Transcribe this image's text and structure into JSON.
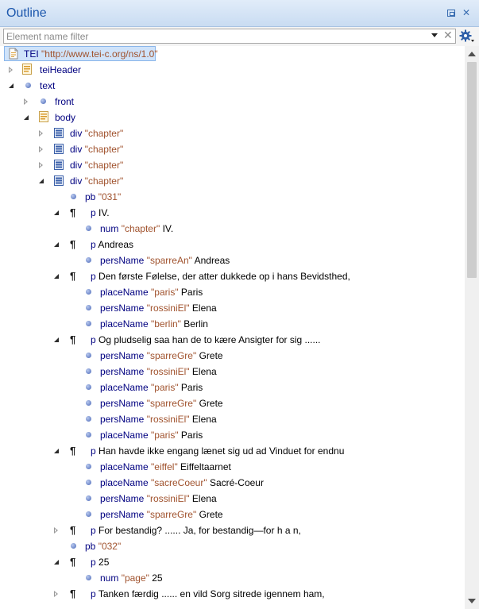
{
  "panel": {
    "title": "Outline",
    "restore_icon": "restore-icon",
    "close_symbol": "✕"
  },
  "filter": {
    "placeholder": "Element name filter",
    "value": "",
    "clear_symbol": "✕"
  },
  "tree": [
    {
      "level": 0,
      "toggle": "none",
      "icon": "document-icon",
      "name": "TEI",
      "attr": "\"http://www.tei-c.org/ns/1.0\"",
      "text": "",
      "selected": true
    },
    {
      "level": 0,
      "toggle": "collapsed",
      "icon": "header-icon",
      "name": "teiHeader",
      "attr": "",
      "text": ""
    },
    {
      "level": 0,
      "toggle": "expanded",
      "icon": "element-dot-icon",
      "name": "text",
      "attr": "",
      "text": ""
    },
    {
      "level": 1,
      "toggle": "collapsed",
      "icon": "element-dot-icon",
      "name": "front",
      "attr": "",
      "text": ""
    },
    {
      "level": 1,
      "toggle": "expanded",
      "icon": "header-icon",
      "name": "body",
      "attr": "",
      "text": ""
    },
    {
      "level": 2,
      "toggle": "collapsed",
      "icon": "div-icon",
      "name": "div",
      "attr": "\"chapter\"",
      "text": ""
    },
    {
      "level": 2,
      "toggle": "collapsed",
      "icon": "div-icon",
      "name": "div",
      "attr": "\"chapter\"",
      "text": ""
    },
    {
      "level": 2,
      "toggle": "collapsed",
      "icon": "div-icon",
      "name": "div",
      "attr": "\"chapter\"",
      "text": ""
    },
    {
      "level": 2,
      "toggle": "expanded",
      "icon": "div-icon",
      "name": "div",
      "attr": "\"chapter\"",
      "text": ""
    },
    {
      "level": 3,
      "toggle": "none",
      "icon": "element-dot-icon",
      "name": "pb",
      "attr": "\"031\"",
      "text": ""
    },
    {
      "level": 3,
      "toggle": "expanded",
      "icon": "pilcrow-icon",
      "name": "p",
      "attr": "",
      "text": "IV."
    },
    {
      "level": 4,
      "toggle": "none",
      "icon": "element-dot-icon",
      "name": "num",
      "attr": "\"chapter\"",
      "text": "IV."
    },
    {
      "level": 3,
      "toggle": "expanded",
      "icon": "pilcrow-icon",
      "name": "p",
      "attr": "",
      "text": "Andreas"
    },
    {
      "level": 4,
      "toggle": "none",
      "icon": "element-dot-icon",
      "name": "persName",
      "attr": "\"sparreAn\"",
      "text": "Andreas"
    },
    {
      "level": 3,
      "toggle": "expanded",
      "icon": "pilcrow-icon",
      "name": "p",
      "attr": "",
      "text": "Den første Følelse, der atter dukkede op i hans Bevidsthed,"
    },
    {
      "level": 4,
      "toggle": "none",
      "icon": "element-dot-icon",
      "name": "placeName",
      "attr": "\"paris\"",
      "text": "Paris"
    },
    {
      "level": 4,
      "toggle": "none",
      "icon": "element-dot-icon",
      "name": "persName",
      "attr": "\"rossiniEl\"",
      "text": "Elena"
    },
    {
      "level": 4,
      "toggle": "none",
      "icon": "element-dot-icon",
      "name": "placeName",
      "attr": "\"berlin\"",
      "text": "Berlin"
    },
    {
      "level": 3,
      "toggle": "expanded",
      "icon": "pilcrow-icon",
      "name": "p",
      "attr": "",
      "text": "Og pludselig saa han de to kære Ansigter for sig ......"
    },
    {
      "level": 4,
      "toggle": "none",
      "icon": "element-dot-icon",
      "name": "persName",
      "attr": "\"sparreGre\"",
      "text": "Grete"
    },
    {
      "level": 4,
      "toggle": "none",
      "icon": "element-dot-icon",
      "name": "persName",
      "attr": "\"rossiniEl\"",
      "text": "Elena"
    },
    {
      "level": 4,
      "toggle": "none",
      "icon": "element-dot-icon",
      "name": "placeName",
      "attr": "\"paris\"",
      "text": "Paris"
    },
    {
      "level": 4,
      "toggle": "none",
      "icon": "element-dot-icon",
      "name": "persName",
      "attr": "\"sparreGre\"",
      "text": "Grete"
    },
    {
      "level": 4,
      "toggle": "none",
      "icon": "element-dot-icon",
      "name": "persName",
      "attr": "\"rossiniEl\"",
      "text": "Elena"
    },
    {
      "level": 4,
      "toggle": "none",
      "icon": "element-dot-icon",
      "name": "placeName",
      "attr": "\"paris\"",
      "text": "Paris"
    },
    {
      "level": 3,
      "toggle": "expanded",
      "icon": "pilcrow-icon",
      "name": "p",
      "attr": "",
      "text": "Han havde ikke engang lænet sig ud ad Vinduet for endnu"
    },
    {
      "level": 4,
      "toggle": "none",
      "icon": "element-dot-icon",
      "name": "placeName",
      "attr": "\"eiffel\"",
      "text": "Eiffeltaarnet"
    },
    {
      "level": 4,
      "toggle": "none",
      "icon": "element-dot-icon",
      "name": "placeName",
      "attr": "\"sacreCoeur\"",
      "text": "Sacré-Coeur"
    },
    {
      "level": 4,
      "toggle": "none",
      "icon": "element-dot-icon",
      "name": "persName",
      "attr": "\"rossiniEl\"",
      "text": "Elena"
    },
    {
      "level": 4,
      "toggle": "none",
      "icon": "element-dot-icon",
      "name": "persName",
      "attr": "\"sparreGre\"",
      "text": "Grete"
    },
    {
      "level": 3,
      "toggle": "collapsed",
      "icon": "pilcrow-icon",
      "name": "p",
      "attr": "",
      "text": "For bestandig? ...... Ja, for bestandig—for h a n,"
    },
    {
      "level": 3,
      "toggle": "none",
      "icon": "element-dot-icon",
      "name": "pb",
      "attr": "\"032\"",
      "text": ""
    },
    {
      "level": 3,
      "toggle": "expanded",
      "icon": "pilcrow-icon",
      "name": "p",
      "attr": "",
      "text": "25"
    },
    {
      "level": 4,
      "toggle": "none",
      "icon": "element-dot-icon",
      "name": "num",
      "attr": "\"page\"",
      "text": "25"
    },
    {
      "level": 3,
      "toggle": "collapsed",
      "icon": "pilcrow-icon",
      "name": "p",
      "attr": "",
      "text": "Tanken færdig ...... en vild Sorg sitrede igennem ham,"
    }
  ]
}
